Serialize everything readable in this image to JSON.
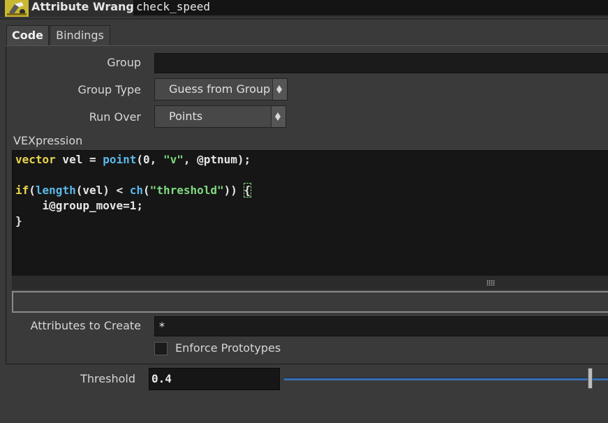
{
  "header": {
    "node_type": "Attribute Wrangle",
    "node_name": "check_speed",
    "icon": "wrangle-node-icon",
    "icon_color": "#c9b832"
  },
  "tabs": [
    {
      "label": "Code",
      "active": true
    },
    {
      "label": "Bindings",
      "active": false
    }
  ],
  "params": {
    "group": {
      "label": "Group",
      "value": ""
    },
    "group_type": {
      "label": "Group Type",
      "value": "Guess from Group"
    },
    "run_over": {
      "label": "Run Over",
      "value": "Points"
    },
    "vexpression_label": "VEXpression",
    "attributes_to_create": {
      "label": "Attributes to Create",
      "value": "*"
    },
    "enforce_prototypes": {
      "label": "Enforce Prototypes",
      "checked": false
    },
    "threshold": {
      "label": "Threshold",
      "value": "0.4",
      "slider_fraction": 0.98
    }
  },
  "code": {
    "l1_kw": "vector",
    "l1_a": " vel = ",
    "l1_fn": "point",
    "l1_b": "(0, ",
    "l1_str": "\"v\"",
    "l1_c": ", @ptnum);",
    "l3_kw": "if",
    "l3_a": "(",
    "l3_fn1": "length",
    "l3_b": "(vel) < ",
    "l3_fn2": "ch",
    "l3_c": "(",
    "l3_str": "\"threshold\"",
    "l3_d": ")) ",
    "l3_brace": "{",
    "l4": "    i@group_move=1;",
    "l5": "}"
  },
  "colors": {
    "keyword": "#e8d44d",
    "function": "#5ab8e8",
    "string": "#7fd97f",
    "slider": "#3a6fb0"
  }
}
